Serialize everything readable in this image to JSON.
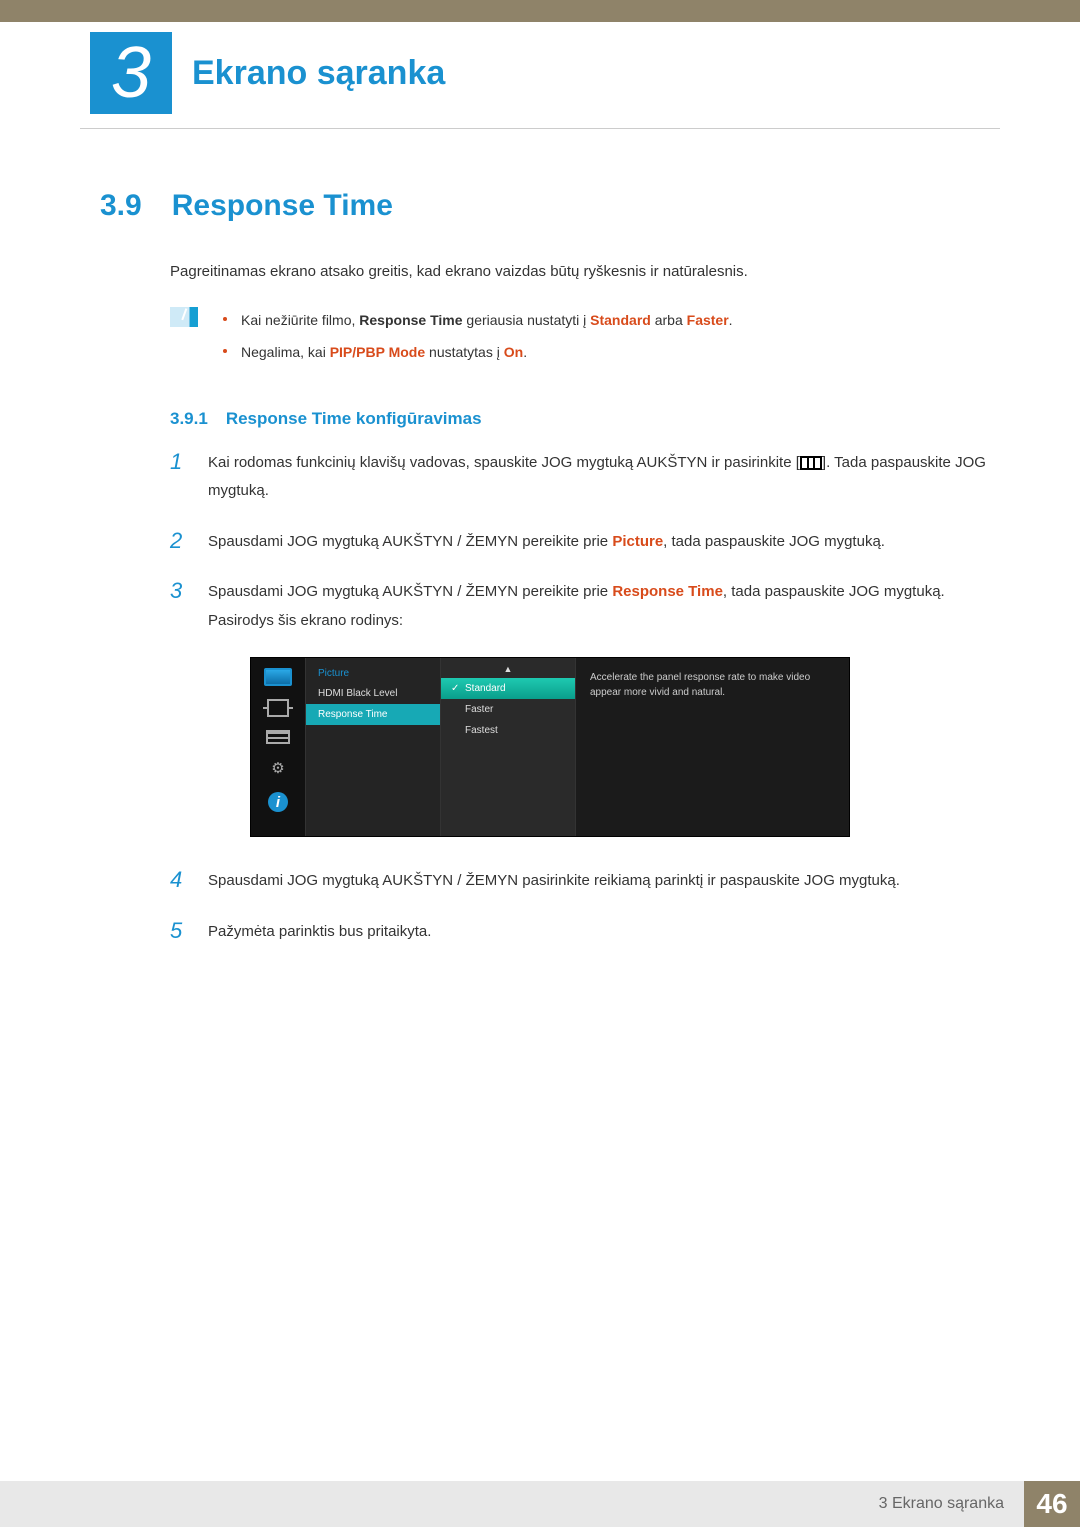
{
  "header": {
    "chapter_number": "3",
    "chapter_title": "Ekrano sąranka"
  },
  "section": {
    "number": "3.9",
    "title": "Response Time",
    "intro": "Pagreitinamas ekrano atsako greitis, kad ekrano vaizdas būtų ryškesnis ir natūralesnis."
  },
  "notes": {
    "bullet1_a": "Kai nežiūrite filmo, ",
    "bullet1_b": "Response Time",
    "bullet1_c": " geriausia nustatyti į ",
    "bullet1_d": "Standard",
    "bullet1_e": " arba ",
    "bullet1_f": "Faster",
    "bullet1_g": ".",
    "bullet2_a": "Negalima, kai ",
    "bullet2_b": "PIP/PBP Mode",
    "bullet2_c": " nustatytas į ",
    "bullet2_d": "On",
    "bullet2_e": "."
  },
  "subsection": {
    "number": "3.9.1",
    "title": "Response Time konfigūravimas"
  },
  "steps": {
    "s1_num": "1",
    "s1_a": "Kai rodomas funkcinių klavišų vadovas, spauskite JOG mygtuką AUKŠTYN ir pasirinkite [",
    "s1_b": "]. Tada paspauskite JOG mygtuką.",
    "s2_num": "2",
    "s2_a": "Spausdami JOG mygtuką AUKŠTYN / ŽEMYN pereikite prie ",
    "s2_b": "Picture",
    "s2_c": ", tada paspauskite JOG mygtuką.",
    "s3_num": "3",
    "s3_a": "Spausdami JOG mygtuką AUKŠTYN / ŽEMYN pereikite prie ",
    "s3_b": "Response Time",
    "s3_c": ", tada paspauskite JOG mygtuką. Pasirodys šis ekrano rodinys:",
    "s4_num": "4",
    "s4": "Spausdami JOG mygtuką AUKŠTYN / ŽEMYN pasirinkite reikiamą parinktį ir paspauskite JOG mygtuką.",
    "s5_num": "5",
    "s5": "Pažymėta parinktis bus pritaikyta."
  },
  "osd": {
    "category": "Picture",
    "items": [
      "HDMI Black Level",
      "Response Time"
    ],
    "selected_item_index": 1,
    "options": [
      "Standard",
      "Faster",
      "Fastest"
    ],
    "selected_option_index": 0,
    "up_arrow": "▲",
    "description": "Accelerate the panel response rate to make video appear more vivid and natural.",
    "info_glyph": "i",
    "gear_glyph": "⚙"
  },
  "footer": {
    "label": "3 Ekrano sąranka",
    "page": "46"
  }
}
